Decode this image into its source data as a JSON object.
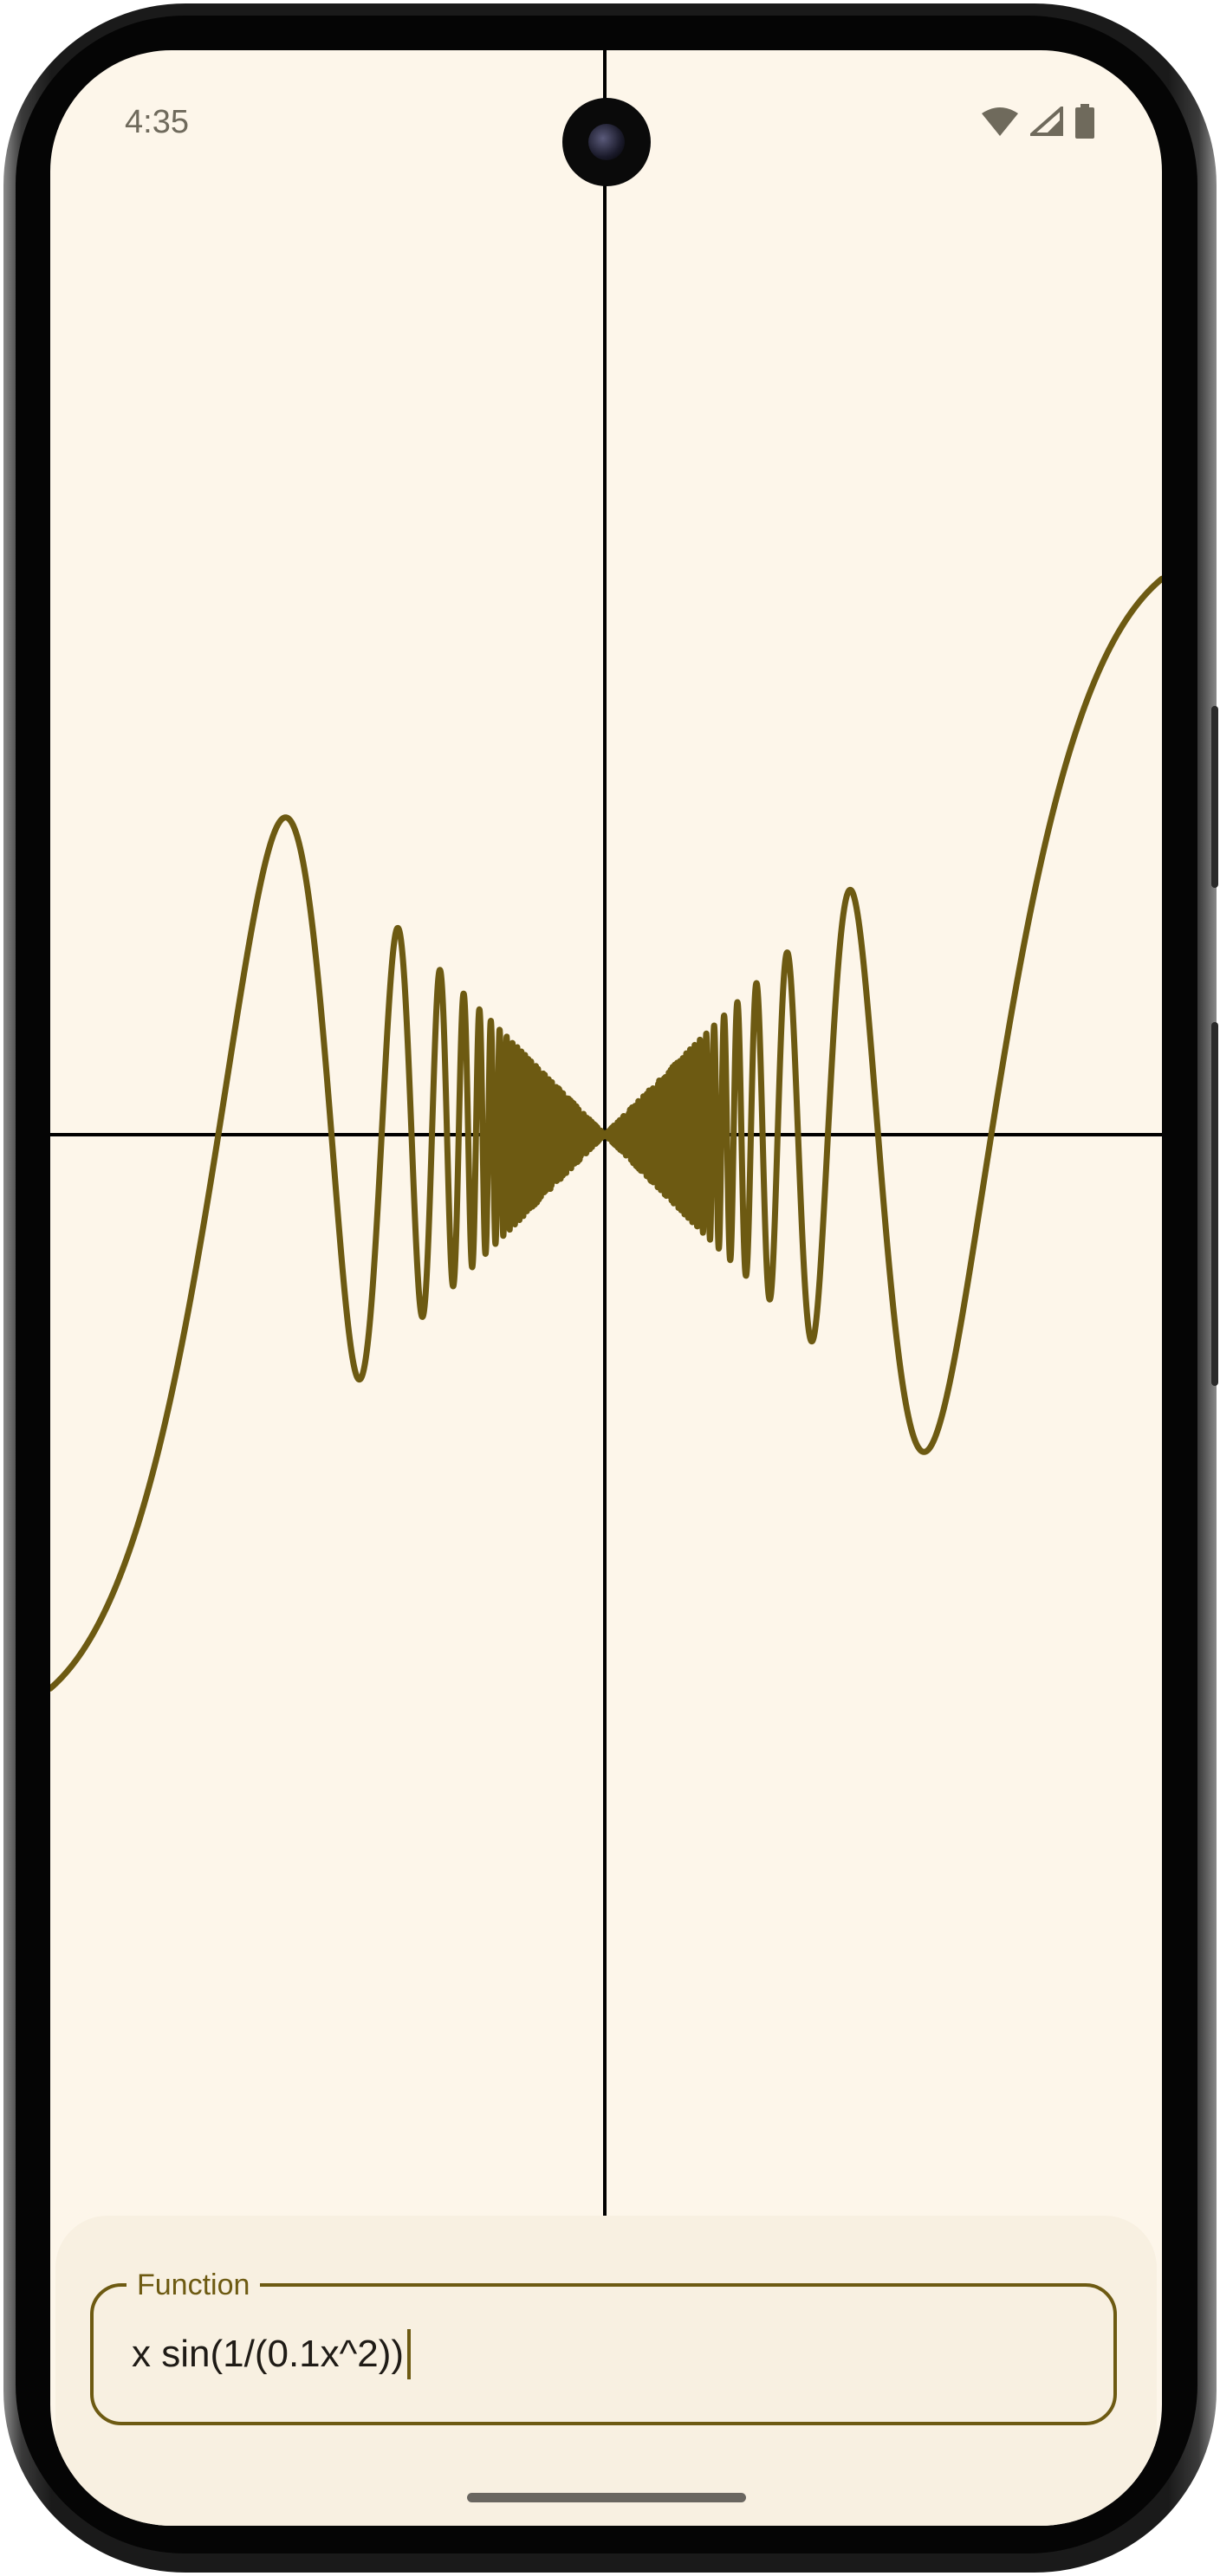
{
  "status_bar": {
    "time": "4:35",
    "icons": [
      "wifi-icon",
      "signal-icon",
      "battery-icon"
    ]
  },
  "graph": {
    "axis_color": "#000000",
    "curve_color": "#6d5a12"
  },
  "function_input": {
    "label": "Function",
    "value": "x sin(1/(0.1x^2))"
  },
  "colors": {
    "background": "#fdf6ea",
    "sheet": "#f8f0e1",
    "accent": "#6d5a12"
  }
}
